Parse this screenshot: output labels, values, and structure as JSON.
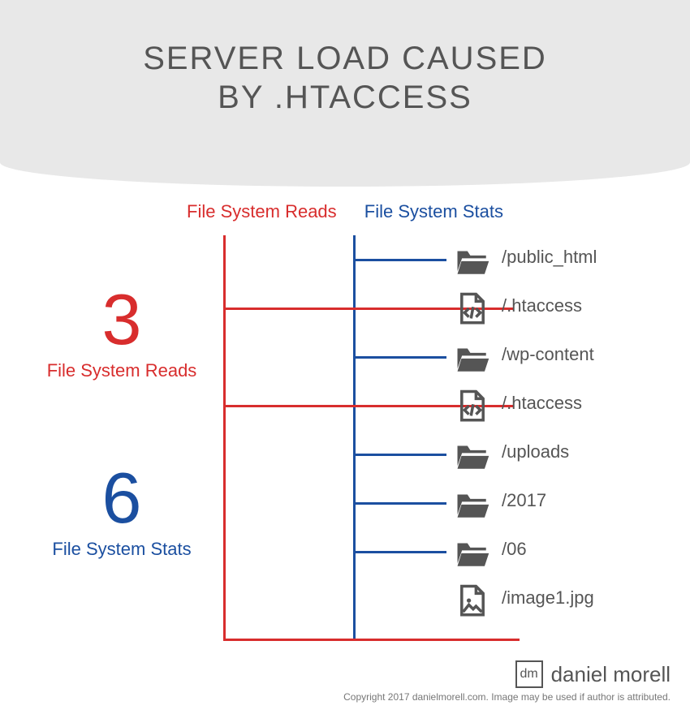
{
  "title": {
    "line1": "SERVER LOAD CAUSED",
    "line2": "BY .HTACCESS"
  },
  "legend": {
    "reads": "File System Reads",
    "stats": "File System Stats"
  },
  "counters": {
    "reads": {
      "value": "3",
      "label": "File System Reads"
    },
    "stats": {
      "value": "6",
      "label": "File System Stats"
    }
  },
  "chart_data": {
    "type": "table",
    "title": "Server load caused by .htaccess",
    "series": [
      {
        "name": "File System Reads",
        "value": 3
      },
      {
        "name": "File System Stats",
        "value": 6
      }
    ],
    "rows": [
      {
        "path": "/public_html",
        "kind": "folder",
        "stat": true,
        "read": false
      },
      {
        "path": "/.htaccess",
        "kind": "code",
        "stat": false,
        "read": true
      },
      {
        "path": "/wp-content",
        "kind": "folder",
        "stat": true,
        "read": false
      },
      {
        "path": "/.htaccess",
        "kind": "code",
        "stat": false,
        "read": true
      },
      {
        "path": "/uploads",
        "kind": "folder",
        "stat": true,
        "read": false
      },
      {
        "path": "/2017",
        "kind": "folder",
        "stat": true,
        "read": false
      },
      {
        "path": "/06",
        "kind": "folder",
        "stat": true,
        "read": false
      },
      {
        "path": "/image1.jpg",
        "kind": "image",
        "stat": true,
        "read": true
      }
    ]
  },
  "footer": {
    "brand": "daniel morell",
    "logo_initials": "dm",
    "copyright": "Copyright 2017 danielmorell.com. Image may be used if author is attributed."
  },
  "icons": {
    "folder": "folder-open-icon",
    "code": "code-file-icon",
    "image": "image-file-icon"
  }
}
